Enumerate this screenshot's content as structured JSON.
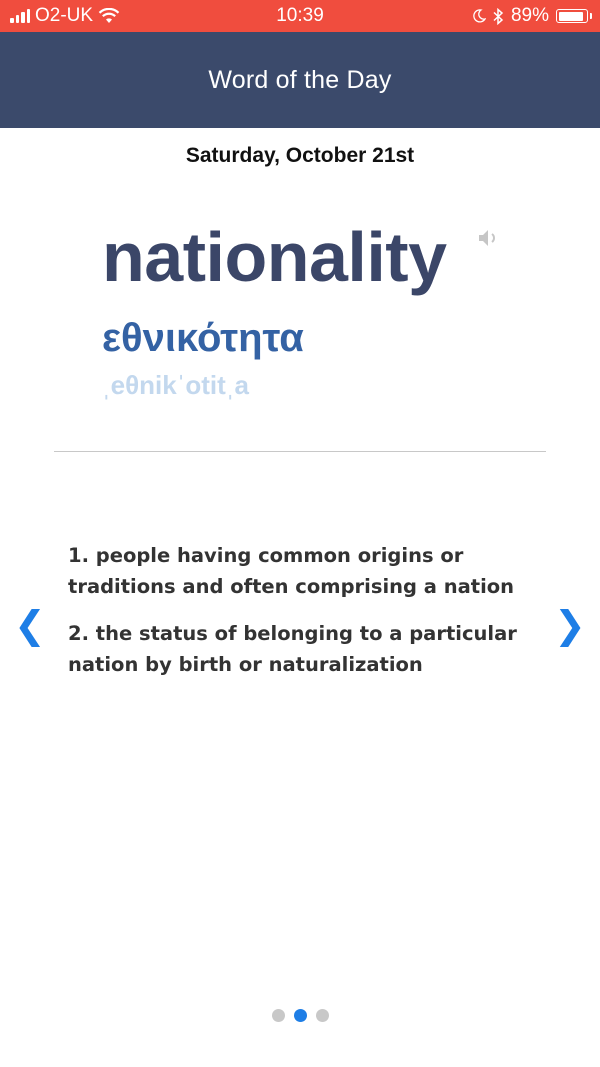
{
  "status_bar": {
    "carrier": "O2-UK",
    "time": "10:39",
    "battery_percent": "89%",
    "battery_level": 0.89,
    "icons": [
      "signal-icon",
      "wifi-icon",
      "moon-icon",
      "bluetooth-icon",
      "battery-icon"
    ]
  },
  "header": {
    "title": "Word of the Day"
  },
  "word_card": {
    "date": "Saturday, October 21st",
    "word": "nationality",
    "translation": "εθνικότητα",
    "transliteration": "ˌeθnikˈotitˌa",
    "speaker_icon": "speaker-icon"
  },
  "definitions": [
    "1. people having common origins or traditions and often comprising a nation",
    "2. the status of belonging to a particular nation by birth or naturalization"
  ],
  "navigation": {
    "prev_label": "❮",
    "next_label": "❯",
    "page_count": 3,
    "active_page": 2
  },
  "colors": {
    "status_bar": "#f04d3e",
    "header": "#3b4a6b",
    "word": "#3b4668",
    "translation": "#3462a4",
    "transliteration": "#c3d8ee",
    "accent": "#1e7ee6"
  }
}
